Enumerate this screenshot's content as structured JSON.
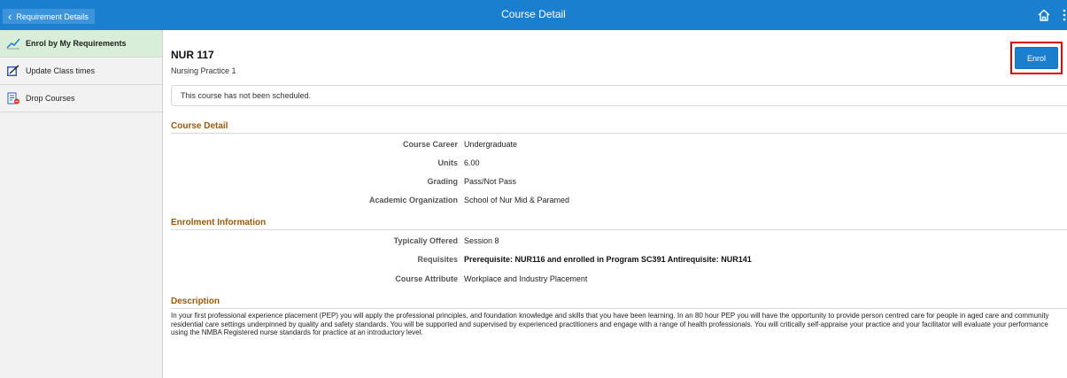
{
  "header": {
    "back_label": "Requirement Details",
    "title": "Course Detail"
  },
  "sidebar": {
    "items": [
      {
        "label": "Enrol by My Requirements",
        "icon": "chart-line-icon"
      },
      {
        "label": "Update Class times",
        "icon": "edit-icon"
      },
      {
        "label": "Drop Courses",
        "icon": "drop-list-icon"
      }
    ]
  },
  "course": {
    "code": "NUR 117",
    "name": "Nursing Practice 1",
    "enrol_label": "Enrol",
    "notice": "This course has not been scheduled."
  },
  "course_detail": {
    "title": "Course Detail",
    "rows": [
      {
        "label": "Course Career",
        "value": "Undergraduate"
      },
      {
        "label": "Units",
        "value": "6.00"
      },
      {
        "label": "Grading",
        "value": "Pass/Not Pass"
      },
      {
        "label": "Academic Organization",
        "value": "School of Nur Mid & Paramed"
      }
    ]
  },
  "enrolment_info": {
    "title": "Enrolment Information",
    "rows": [
      {
        "label": "Typically Offered",
        "value": "Session 8"
      },
      {
        "label": "Requisites",
        "value": "Prerequisite: NUR116 and enrolled in Program SC391 Antirequisite: NUR141"
      },
      {
        "label": "Course Attribute",
        "value": "Workplace and Industry Placement"
      }
    ]
  },
  "description": {
    "title": "Description",
    "text": "In your first professional experience placement (PEP) you will apply the professional principles, and foundation knowledge and skills that you have been learning. In an 80 hour PEP you will have the opportunity to provide person centred care for people in aged care and community residential care settings underpinned by quality and safety standards.  You will be supported and supervised by experienced practitioners and engage with a range of health professionals. You will critically self-appraise your practice and your facilitator will evaluate your performance using the NMBA Registered nurse standards for practice at an introductory level."
  },
  "colors": {
    "header_blue": "#1b7fd0",
    "section_title": "#9a5a0a",
    "active_nav": "#d8eed8",
    "highlight_red": "#e00000"
  }
}
